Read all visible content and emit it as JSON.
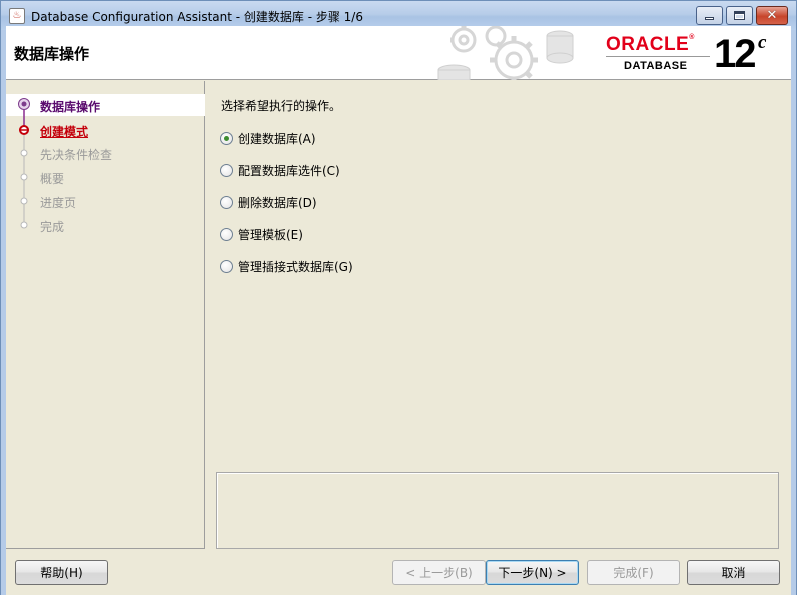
{
  "window": {
    "title": "Database Configuration Assistant - 创建数据库 - 步骤 1/6",
    "app_icon": "java-cup-icon"
  },
  "header": {
    "title": "数据库操作",
    "logo": {
      "brand": "ORACLE",
      "registered": "®",
      "product": "DATABASE",
      "version": "12",
      "version_suffix": "c"
    }
  },
  "steps": [
    {
      "label": "数据库操作",
      "state": "current"
    },
    {
      "label": "创建模式",
      "state": "next-link"
    },
    {
      "label": "先决条件检查",
      "state": "disabled"
    },
    {
      "label": "概要",
      "state": "disabled"
    },
    {
      "label": "进度页",
      "state": "disabled"
    },
    {
      "label": "完成",
      "state": "disabled"
    }
  ],
  "content": {
    "prompt": "选择希望执行的操作。",
    "options": [
      {
        "label": "创建数据库(A)",
        "selected": true
      },
      {
        "label": "配置数据库选件(C)",
        "selected": false
      },
      {
        "label": "删除数据库(D)",
        "selected": false
      },
      {
        "label": "管理模板(E)",
        "selected": false
      },
      {
        "label": "管理插接式数据库(G)",
        "selected": false
      }
    ],
    "message": ""
  },
  "buttons": {
    "help": "帮助(H)",
    "back": "< 上一步(B)",
    "next": "下一步(N) >",
    "finish": "完成(F)",
    "cancel": "取消"
  },
  "colors": {
    "oracle_red": "#e2001a",
    "current_step": "#5a0b6e",
    "link_step": "#c4000b",
    "disabled_text": "#9a9a9a",
    "panel_bg": "#ece9d8"
  }
}
